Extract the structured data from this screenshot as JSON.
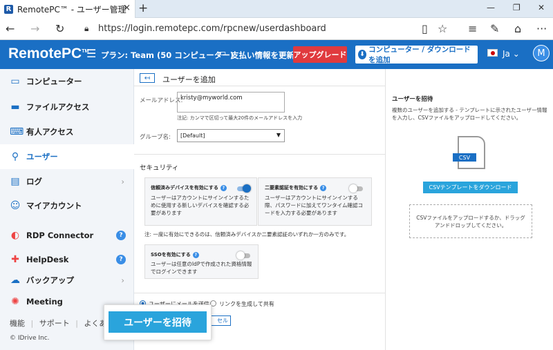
{
  "browser": {
    "tab_title": "RemotePC™ - ユーザー管理",
    "favicon_letter": "R",
    "tab_close": "×",
    "new_tab": "+",
    "url": "https://login.remotepc.com/rpcnew/userdashboard"
  },
  "header": {
    "logo": "RemotePC",
    "logo_tm": "TM",
    "plan": "プラン: Team (50 コンピューター)",
    "billing": "支払い情報を更新",
    "upgrade": "アップグレード",
    "download": "コンピューター / ダウンロード を追加",
    "language": "Ja",
    "avatar": "M"
  },
  "sidebar": {
    "items": [
      {
        "label": "コンピューター",
        "icon": "monitor-icon"
      },
      {
        "label": "ファイルアクセス",
        "icon": "drive-icon"
      },
      {
        "label": "有人アクセス",
        "icon": "keyboard-icon"
      },
      {
        "label": "ユーザー",
        "icon": "users-icon",
        "active": true
      },
      {
        "label": "ログ",
        "icon": "log-icon"
      },
      {
        "label": "マイアカウント",
        "icon": "account-icon"
      },
      {
        "label": "RDP Connector",
        "icon": "rdp-icon"
      },
      {
        "label": "HelpDesk",
        "icon": "helpdesk-icon"
      },
      {
        "label": "バックアップ",
        "icon": "backup-icon"
      },
      {
        "label": "Meeting",
        "icon": "meeting-icon"
      }
    ],
    "footer": {
      "features": "機能",
      "support": "サポート",
      "faq": "よくある質"
    },
    "copyright": "© IDrive Inc."
  },
  "form": {
    "title": "ユーザーを追加",
    "email_label": "メールアドレス:",
    "email_value": "kristy@myworld.com",
    "email_note": "注記: カンマで区切って最大20件のメールアドレスを入力",
    "group_label": "グループ名:",
    "group_value": "[Default]",
    "security_title": "セキュリティ",
    "trusted": {
      "title": "信頼済みデバイスを有効にする",
      "desc": "ユーザーはアカウントにサインインするために使用する新しいデバイスを確認する必要があります",
      "enabled": true
    },
    "twofa": {
      "title": "二要素認証を有効にする",
      "desc": "ユーザーはアカウントにサインインする際、パスワードに加えてワンタイム確認コードを入力する必要があります",
      "enabled": false
    },
    "security_note": "注: 一度に有効にできるのは、信頼済みデバイスか二要素認証のいずれか一方のみです。",
    "sso": {
      "title": "SSOを有効にする",
      "desc": "ユーザーは任意のIdPで作成された資格情報でログインできます",
      "enabled": false
    },
    "radio_email": "ユーザーにメールを送信",
    "radio_link": "リンクを生成して共有",
    "cancel": "セル",
    "invite": "ユーザーを招待"
  },
  "invite_panel": {
    "title": "ユーザーを招待",
    "desc": "複数のユーザーを追加する - テンプレートに示されたユーザー情報を入力し、CSVファイルをアップロードしてください。",
    "csv_label": "CSV",
    "download_btn": "CSVテンプレートをダウンロード",
    "drop_text": "CSVファイルをアップロードするか、ドラッグアンドドロップしてください。"
  }
}
